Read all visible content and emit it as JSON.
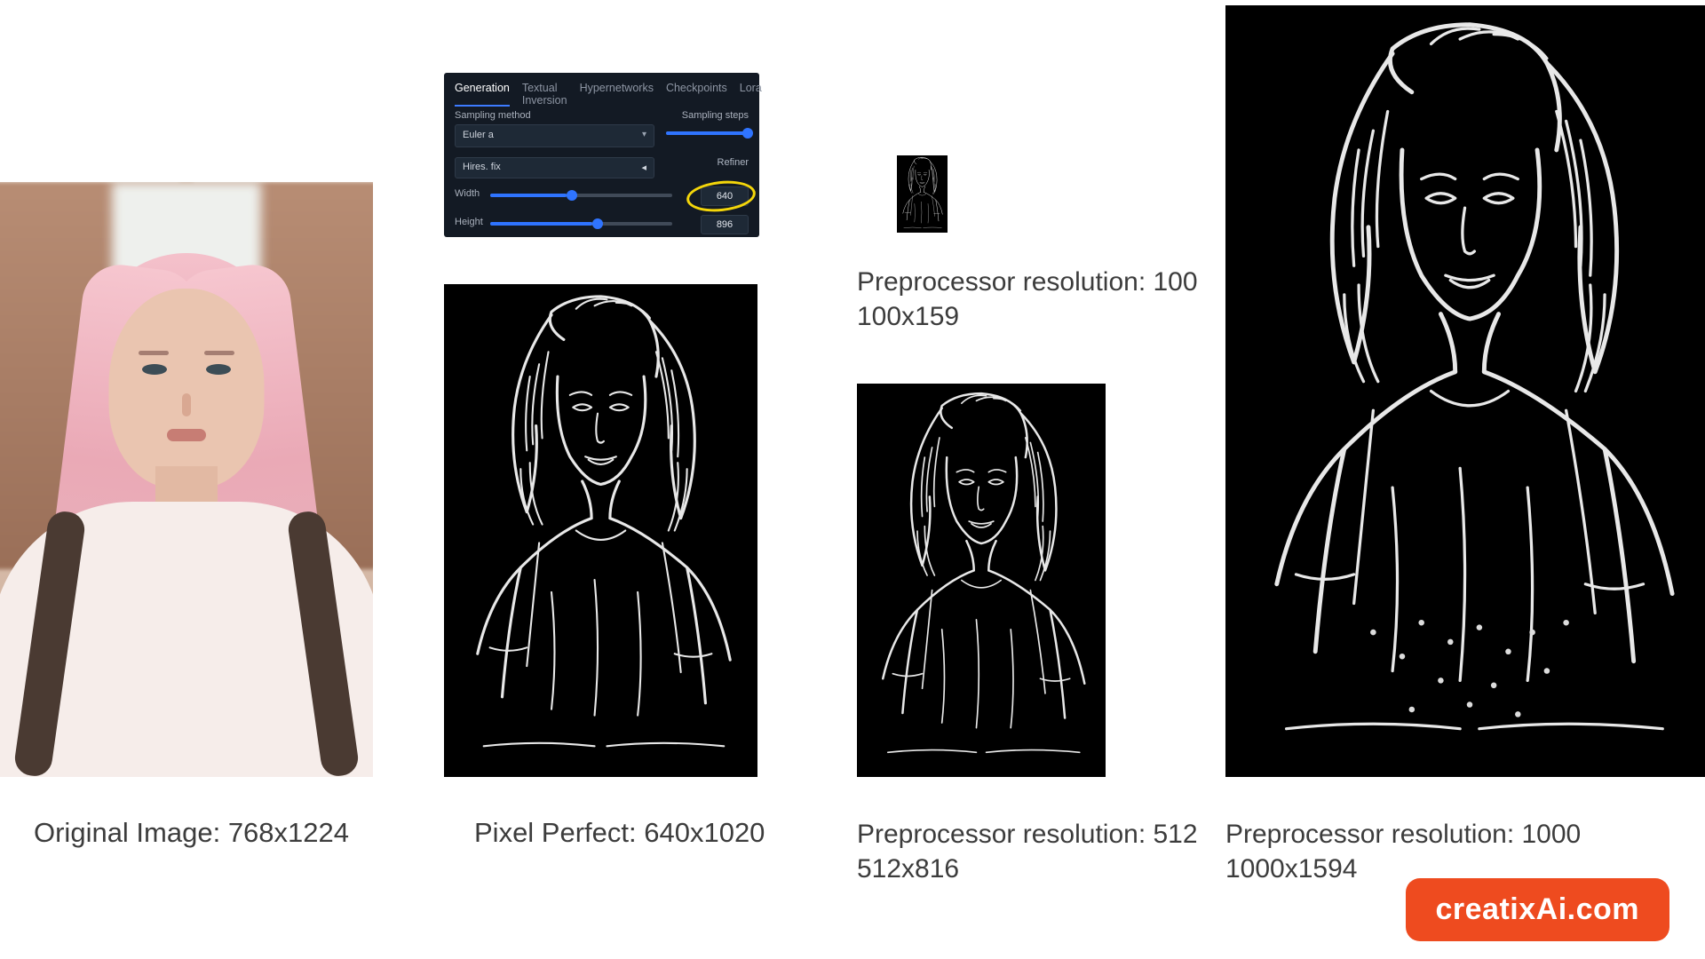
{
  "column1": {
    "caption": "Original Image: 768x1224"
  },
  "panel": {
    "tabs": [
      "Generation",
      "Textual Inversion",
      "Hypernetworks",
      "Checkpoints",
      "Lora"
    ],
    "sampling_method_label": "Sampling method",
    "sampling_method_value": "Euler a",
    "sampling_steps_label": "Sampling steps",
    "hires_fix_label": "Hires. fix",
    "refiner_label": "Refiner",
    "width_label": "Width",
    "height_label": "Height",
    "width_value": "640",
    "height_value": "896"
  },
  "column2": {
    "caption": "Pixel Perfect: 640x1020"
  },
  "column3": {
    "caption_100_line1": "Preprocessor resolution: 100",
    "caption_100_line2": "100x159",
    "caption_512_line1": "Preprocessor resolution: 512",
    "caption_512_line2": "512x816"
  },
  "column4": {
    "caption_line1": "Preprocessor resolution: 1000",
    "caption_line2": "1000x1594"
  },
  "brand": "creatixAi.com"
}
